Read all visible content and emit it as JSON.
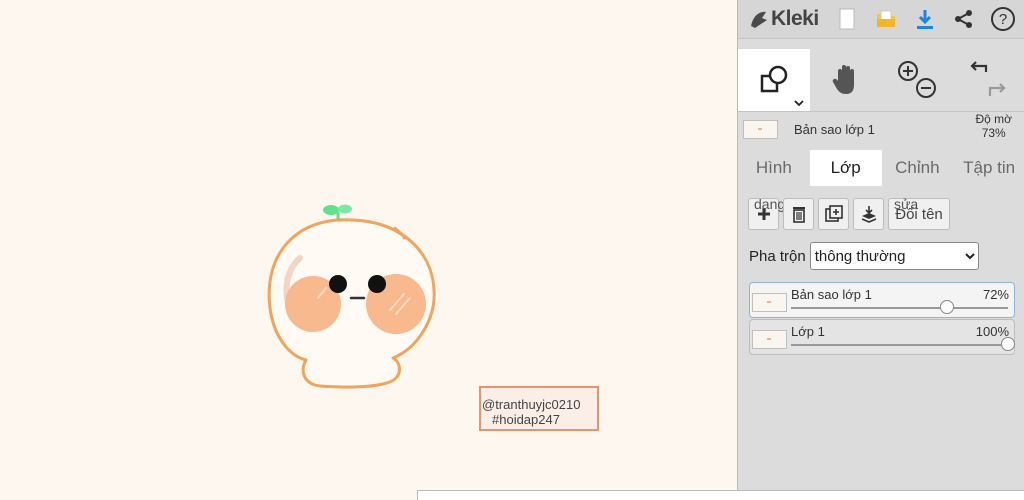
{
  "app": {
    "name": "Kleki"
  },
  "topbar": {
    "icons": [
      "kleki-logo-icon",
      "new-file-icon",
      "open-folder-icon",
      "download-icon",
      "share-icon",
      "help-icon"
    ]
  },
  "tools": [
    {
      "icon": "shape-tool-icon",
      "active": true
    },
    {
      "icon": "hand-tool-icon",
      "active": false
    },
    {
      "icon": "zoom-icon",
      "active": false
    },
    {
      "icon": "undo-redo-icon",
      "active": false
    }
  ],
  "current_layer": {
    "name": "Bản sao lớp 1",
    "opacity_label": "Độ mờ",
    "opacity_value": "73%"
  },
  "tabs": [
    {
      "label": "Hình",
      "active": false
    },
    {
      "label": "Lớp",
      "active": true
    },
    {
      "label": "Chỉnh",
      "active": false
    },
    {
      "label": "Tập tin",
      "active": false
    }
  ],
  "layer_buttons": {
    "add_icon": "plus-icon",
    "delete_icon": "trash-icon",
    "duplicate_icon": "duplicate-icon",
    "merge_icon": "merge-down-icon",
    "rename_label": "Đổi tên",
    "overlay_left": "dạng",
    "overlay_right": "sửa"
  },
  "blend": {
    "label": "Pha trộn",
    "selected": "thông thường"
  },
  "layers": [
    {
      "name": "Bản sao lớp 1",
      "percent": "72%",
      "opacity": 0.72,
      "selected": true
    },
    {
      "name": "Lớp 1",
      "percent": "100%",
      "opacity": 1.0,
      "selected": false
    }
  ],
  "canvas": {
    "watermark_line1": "@tranthuyjc0210",
    "watermark_line2": "#hoidap247"
  },
  "colors": {
    "canvas_bg": "#fdf7f0",
    "panel_bg": "#dcdcdc",
    "mascot_outline": "#f0a45c",
    "cheek": "#f8b98e",
    "sprout": "#5fe08a",
    "watermark_border": "#e8936a"
  }
}
